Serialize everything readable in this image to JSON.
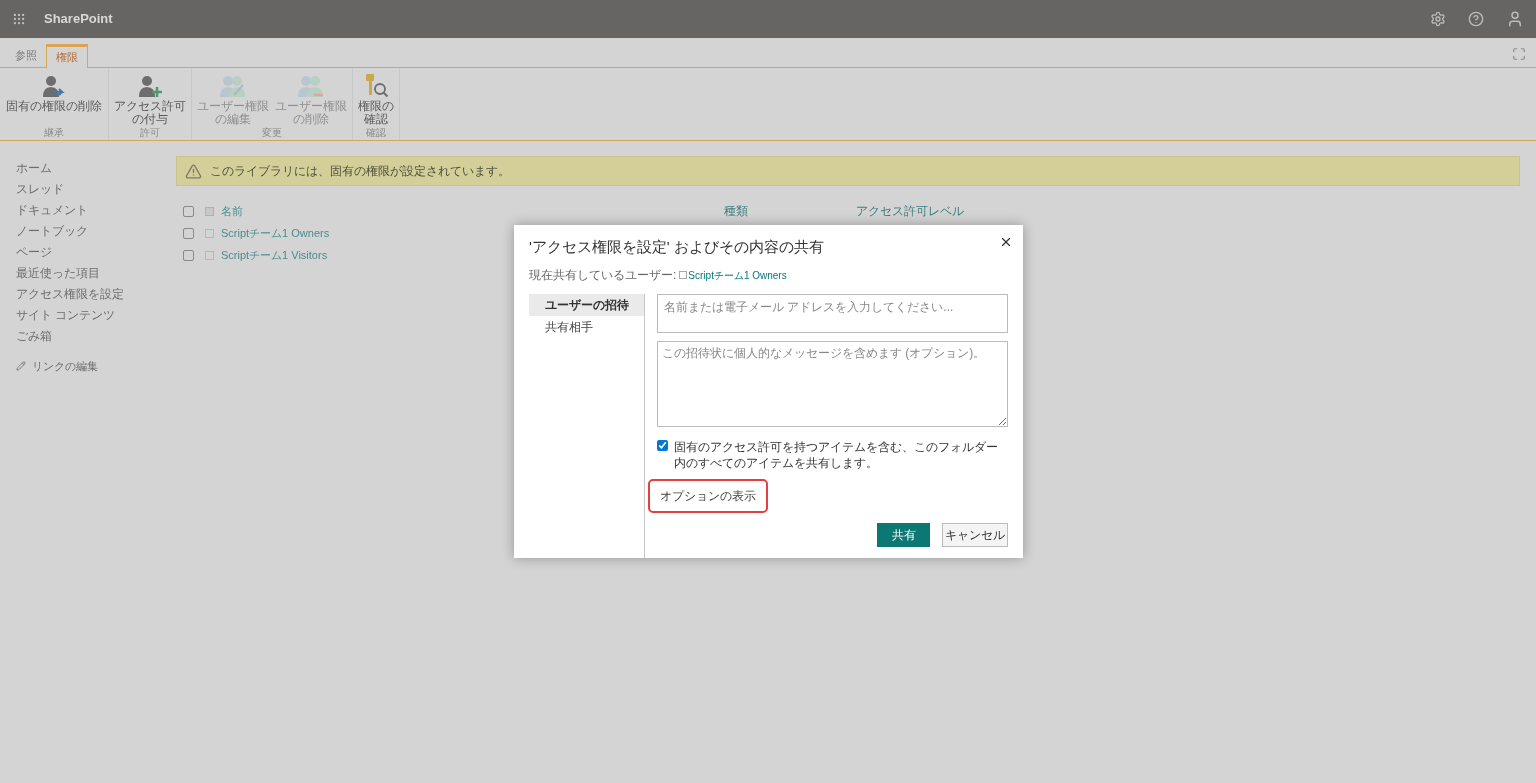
{
  "suite_bar": {
    "app_name": "SharePoint"
  },
  "ribbon": {
    "tabs": [
      {
        "label": "参照",
        "selected": false
      },
      {
        "label": "権限",
        "selected": true
      }
    ],
    "groups": [
      {
        "label": "継承",
        "buttons": [
          {
            "label": "固有の権限の削除",
            "disabled": false
          }
        ]
      },
      {
        "label": "許可",
        "buttons": [
          {
            "label": "アクセス許可の付与",
            "disabled": false
          }
        ]
      },
      {
        "label": "変更",
        "buttons": [
          {
            "label": "ユーザー権限の編集",
            "disabled": true
          },
          {
            "label": "ユーザー権限の削除",
            "disabled": true
          }
        ]
      },
      {
        "label": "確認",
        "buttons": [
          {
            "label": "権限の確認",
            "disabled": false
          }
        ]
      }
    ]
  },
  "nav": {
    "items": [
      "ホーム",
      "スレッド",
      "ドキュメント",
      "ノートブック",
      "ページ",
      "最近使った項目",
      "アクセス権限を設定",
      "サイト コンテンツ",
      "ごみ箱"
    ],
    "edit_links": "リンクの編集"
  },
  "notice": "このライブラリには、固有の権限が設定されています。",
  "table": {
    "all_checked": false,
    "columns": [
      "名前",
      "種類",
      "アクセス許可レベル"
    ],
    "rows": [
      {
        "name": "Scriptチーム1 Owners",
        "checked": false
      },
      {
        "name": "Scriptチーム1 Visitors",
        "checked": false
      }
    ]
  },
  "dialog": {
    "title": "'アクセス権限を設定' およびその内容の共有",
    "shared_with_label": "現在共有しているユーザー:",
    "shared_with": "Scriptチーム1 Owners",
    "tabs": [
      {
        "label": "ユーザーの招待",
        "selected": true
      },
      {
        "label": "共有相手",
        "selected": false
      }
    ],
    "people_field": {
      "placeholder": "名前または電子メール アドレスを入力してください..."
    },
    "message_field": {
      "placeholder": "この招待状に個人的なメッセージを含めます (オプション)。"
    },
    "share_all": {
      "label": "固有のアクセス許可を持つアイテムを含む、このフォルダー内のすべてのアイテムを共有します。",
      "checked": true
    },
    "options_link": "オプションの表示",
    "buttons": [
      {
        "label": "共有",
        "kind": "primary"
      },
      {
        "label": "キャンセル",
        "kind": "secondary"
      }
    ]
  }
}
